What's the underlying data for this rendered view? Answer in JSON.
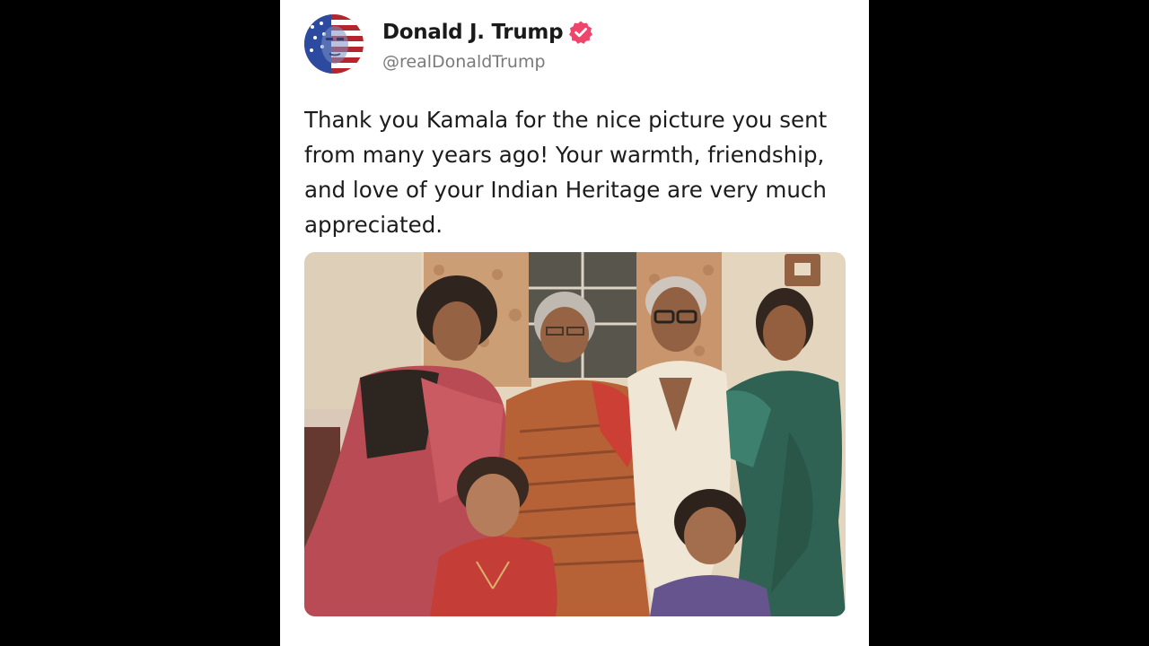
{
  "post": {
    "author_name": "Donald J. Trump",
    "author_handle": "@realDonaldTrump",
    "verified": true,
    "text": "Thank you Kamala for the nice picture you sent from many years ago! Your warmth, friendship, and love of your Indian Heritage are very much appreciated.",
    "avatar_icon": "profile-avatar-flag",
    "verified_icon": "verified-badge-icon",
    "photo_icon": "family-photo"
  },
  "colors": {
    "page_background": "#000000",
    "card_background": "#ffffff",
    "verified_badge": "#f0456b",
    "handle_text": "#7a7a7a"
  }
}
